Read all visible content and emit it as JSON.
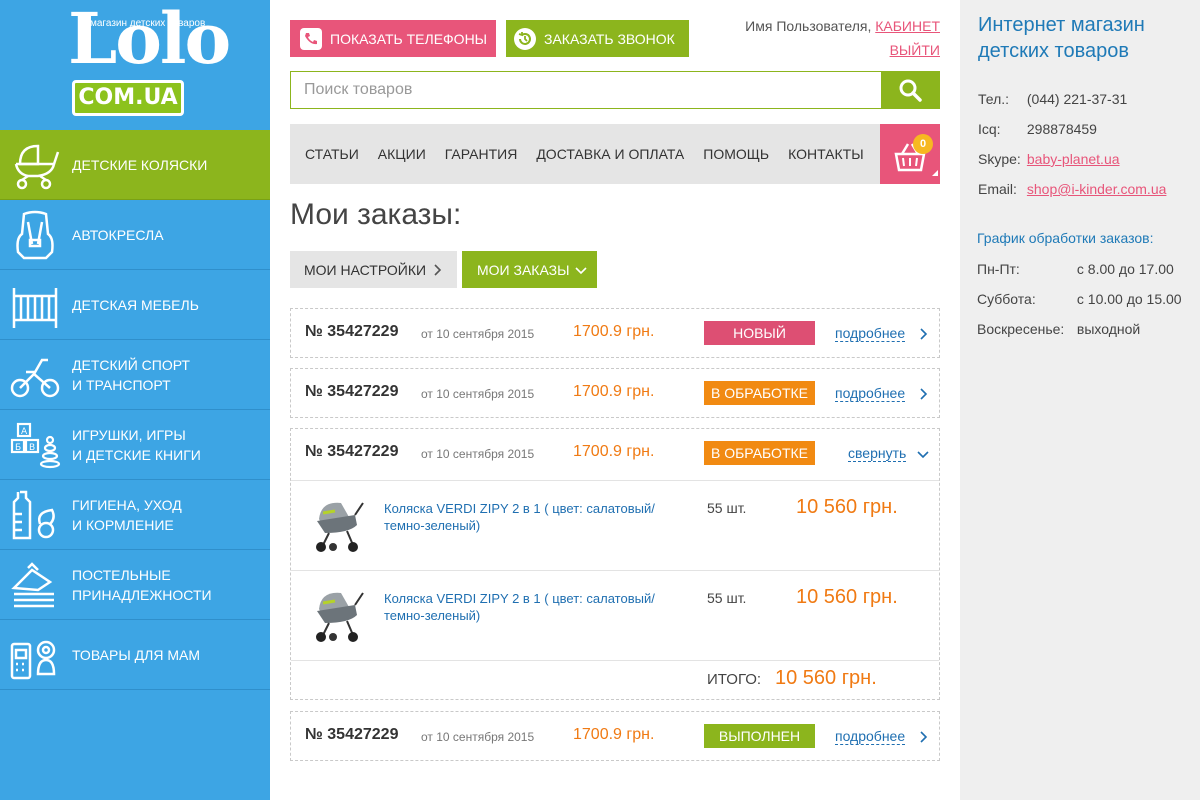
{
  "logo": {
    "tagline": "магазин детских товаров",
    "brand": "Lolo",
    "domain": "COM.UA"
  },
  "categories": [
    {
      "label": "ДЕТСКИЕ КОЛЯСКИ",
      "icon": "stroller-icon",
      "active": true
    },
    {
      "label": "АВТОКРЕСЛА",
      "icon": "car-seat-icon",
      "active": false
    },
    {
      "label": "ДЕТСКАЯ МЕБЕЛЬ",
      "icon": "crib-icon",
      "active": false
    },
    {
      "label": "ДЕТСКИЙ СПОРТ\nИ ТРАНСПОРТ",
      "icon": "tricycle-icon",
      "active": false
    },
    {
      "label": "ИГРУШКИ, ИГРЫ\nИ ДЕТСКИЕ КНИГИ",
      "icon": "toy-blocks-icon",
      "active": false
    },
    {
      "label": "ГИГИЕНА, УХОД\nИ КОРМЛЕНИЕ",
      "icon": "baby-bottle-icon",
      "active": false
    },
    {
      "label": "ПОСТЕЛЬНЫЕ\nПРИНАДЛЕЖНОСТИ",
      "icon": "bedding-icon",
      "active": false
    },
    {
      "label": "ТОВАРЫ ДЛЯ МАМ",
      "icon": "baby-monitor-icon",
      "active": false
    }
  ],
  "header": {
    "show_phones": "ПОКАЗАТЬ ТЕЛЕФОНЫ",
    "order_call": "ЗАКАЗАТЬ ЗВОНОК",
    "user_name": "Имя Пользователя,",
    "cabinet": "КАБИНЕТ",
    "logout": "ВЫЙТИ"
  },
  "search": {
    "placeholder": "Поиск товаров"
  },
  "nav": [
    "СТАТЬИ",
    "АКЦИИ",
    "ГАРАНТИЯ",
    "ДОСТАВКА И ОПЛАТА",
    "ПОМОЩЬ",
    "КОНТАКТЫ"
  ],
  "cart": {
    "count": "0"
  },
  "page": {
    "title": "Мои заказы:",
    "tab_settings": "МОИ НАСТРОЙКИ",
    "tab_orders": "МОИ ЗАКАЗЫ"
  },
  "orders": [
    {
      "number": "№ 35427229",
      "date": "от 10 сентября 2015",
      "sum": "1700.9 грн.",
      "status": "НОВЫЙ",
      "status_color": "#dd4f73",
      "link": "подробнее",
      "expanded": false
    },
    {
      "number": "№ 35427229",
      "date": "от 10 сентября 2015",
      "sum": "1700.9 грн.",
      "status": "В ОБРАБОТКЕ",
      "status_color": "#f18a12",
      "link": "подробнее",
      "expanded": false
    },
    {
      "number": "№ 35427229",
      "date": "от 10 сентября 2015",
      "sum": "1700.9 грн.",
      "status": "В ОБРАБОТКЕ",
      "status_color": "#f18a12",
      "link": "свернуть",
      "expanded": true,
      "items": [
        {
          "name": "Коляска VERDI ZIPY 2 в 1 ( цвет: салатовый/ темно-зеленый)",
          "qty": "55 шт.",
          "price": "10 560 грн."
        },
        {
          "name": "Коляска VERDI ZIPY 2 в 1 ( цвет: салатовый/ темно-зеленый)",
          "qty": "55 шт.",
          "price": "10 560 грн."
        }
      ],
      "total_label": "ИТОГО:",
      "total_value": "10 560 грн."
    },
    {
      "number": "№ 35427229",
      "date": "от 10 сентября 2015",
      "sum": "1700.9 грн.",
      "status": "ВЫПОЛНЕН",
      "status_color": "#8cb51d",
      "link": "подробнее",
      "expanded": false
    }
  ],
  "aside": {
    "title": "Интернет магазин детских товаров",
    "contacts": [
      {
        "key": "Тел.:",
        "value": "(044) 221-37-31",
        "link": false
      },
      {
        "key": "Icq:",
        "value": "298878459",
        "link": false
      },
      {
        "key": "Skype:",
        "value": "baby-planet.ua",
        "link": true
      },
      {
        "key": "Email:",
        "value": "shop@i-kinder.com.ua",
        "link": true
      }
    ],
    "schedule_title": "График обработки заказов:",
    "schedule": [
      {
        "day": "Пн-Пт:",
        "time": "с 8.00 до 17.00"
      },
      {
        "day": "Суббота:",
        "time": "с 10.00 до 15.00"
      },
      {
        "day": "Воскресенье:",
        "time": "выходной"
      }
    ]
  },
  "colors": {
    "brand_blue": "#3da5e4",
    "green": "#8cb51d",
    "pink": "#e8557a",
    "orange": "#f07a13"
  }
}
